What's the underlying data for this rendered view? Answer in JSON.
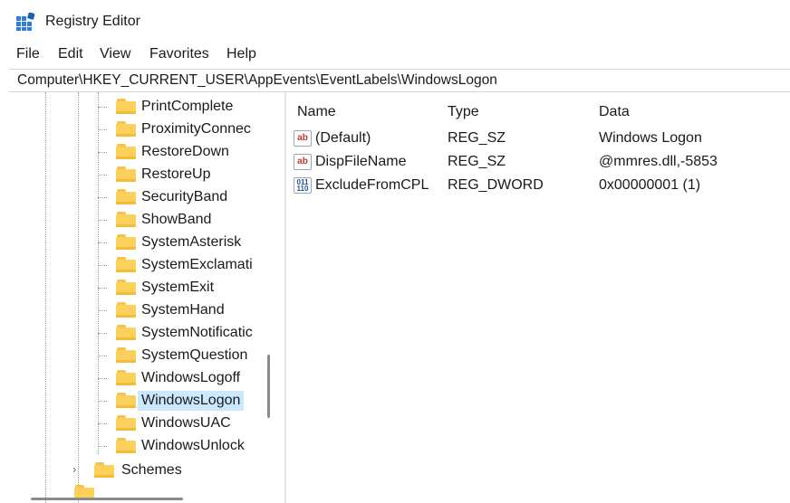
{
  "app": {
    "title": "Registry Editor",
    "icon": "registry-editor-icon"
  },
  "menu": [
    "File",
    "Edit",
    "View",
    "Favorites",
    "Help"
  ],
  "address": "Computer\\HKEY_CURRENT_USER\\AppEvents\\EventLabels\\WindowsLogon",
  "tree": {
    "items": [
      {
        "label": "PrintComplete"
      },
      {
        "label": "ProximityConnec"
      },
      {
        "label": "RestoreDown"
      },
      {
        "label": "RestoreUp"
      },
      {
        "label": "SecurityBand"
      },
      {
        "label": "ShowBand"
      },
      {
        "label": "SystemAsterisk"
      },
      {
        "label": "SystemExclamati"
      },
      {
        "label": "SystemExit"
      },
      {
        "label": "SystemHand"
      },
      {
        "label": "SystemNotificatic"
      },
      {
        "label": "SystemQuestion"
      },
      {
        "label": "WindowsLogoff"
      },
      {
        "label": "WindowsLogon",
        "selected": true
      },
      {
        "label": "WindowsUAC"
      },
      {
        "label": "WindowsUnlock"
      }
    ],
    "parent_sibling": {
      "label": "Schemes",
      "chevron": "›"
    }
  },
  "list": {
    "columns": {
      "name": "Name",
      "type": "Type",
      "data": "Data"
    },
    "rows": [
      {
        "icon": "ab",
        "icon_name": "string-value-icon",
        "name": "(Default)",
        "type": "REG_SZ",
        "data": "Windows Logon"
      },
      {
        "icon": "ab",
        "icon_name": "string-value-icon",
        "name": "DispFileName",
        "type": "REG_SZ",
        "data": "@mmres.dll,-5853"
      },
      {
        "icon": "011\n110",
        "icon_name": "binary-value-icon",
        "name": "ExcludeFromCPL",
        "type": "REG_DWORD",
        "data": "0x00000001 (1)"
      }
    ]
  },
  "colors": {
    "selection": "#cce8ff",
    "folder": "#fcd15b"
  }
}
